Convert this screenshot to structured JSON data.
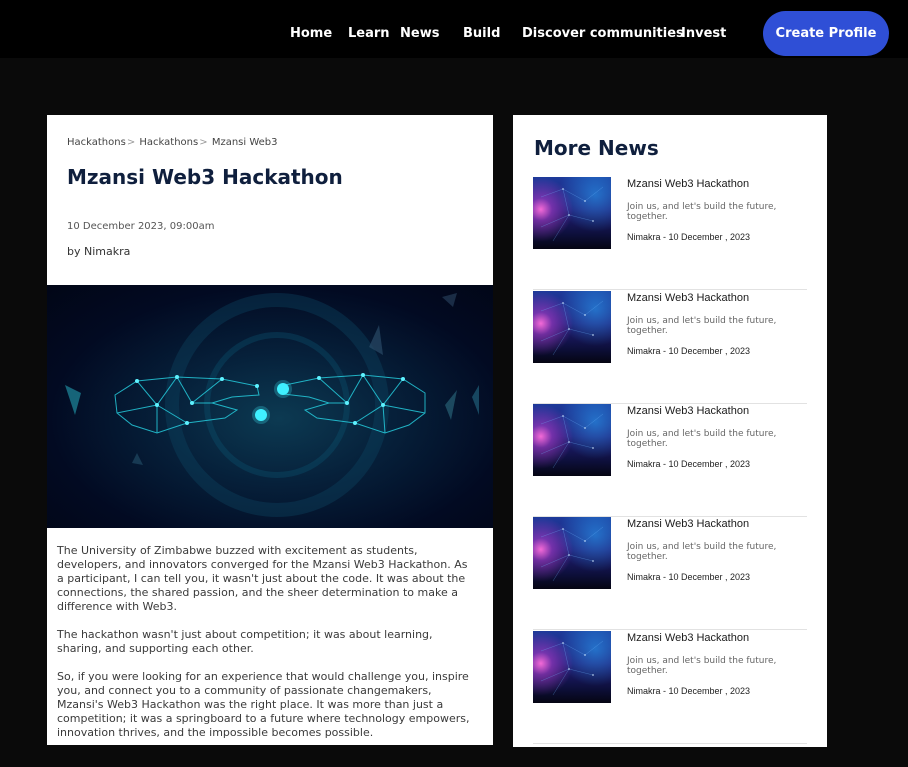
{
  "nav": {
    "items": [
      {
        "label": "Home"
      },
      {
        "label": "Learn"
      },
      {
        "label": "News"
      },
      {
        "label": "Build"
      },
      {
        "label": "Discover communities"
      },
      {
        "label": "Invest"
      }
    ],
    "cta_label": "Create Profile",
    "accent_color": "#2f4fd6"
  },
  "article": {
    "breadcrumb": [
      "Hackathons",
      "Hackathons",
      "Mzansi Web3"
    ],
    "breadcrumb_separator": ">",
    "title": "Mzansi Web3 Hackathon",
    "date": "10 December 2023, 09:00am",
    "author": "by Nimakra",
    "hero_image": "digital-hands-reaching",
    "paragraphs": [
      "The University of Zimbabwe buzzed with excitement as students, developers, and innovators converged for the Mzansi Web3 Hackathon. As a participant, I can tell you, it wasn't just about the code. It was about the connections, the shared passion, and the sheer determination to make a difference with Web3.",
      "The hackathon wasn't just about competition; it was about learning, sharing, and supporting each other.",
      "So, if you were looking for an experience that would challenge you, inspire you, and connect you to a community of passionate changemakers, Mzansi's Web3 Hackathon was the right place. It was more than just a competition; it was a springboard to a future where technology empowers, innovation thrives, and the impossible becomes possible."
    ]
  },
  "more_news": {
    "title": "More News",
    "items": [
      {
        "title": "Mzansi Web3 Hackathon",
        "excerpt": "Join us, and let's build the future, together.",
        "meta": "Nimakra - 10 December , 2023"
      },
      {
        "title": "Mzansi Web3 Hackathon",
        "excerpt": "Join us, and let's build the future, together.",
        "meta": "Nimakra - 10 December , 2023"
      },
      {
        "title": "Mzansi Web3 Hackathon",
        "excerpt": "Join us, and let's build the future, together.",
        "meta": "Nimakra - 10 December , 2023"
      },
      {
        "title": "Mzansi Web3 Hackathon",
        "excerpt": "Join us, and let's build the future, together.",
        "meta": "Nimakra - 10 December , 2023"
      },
      {
        "title": "Mzansi Web3 Hackathon",
        "excerpt": "Join us, and let's build the future, together.",
        "meta": "Nimakra - 10 December , 2023"
      }
    ]
  }
}
